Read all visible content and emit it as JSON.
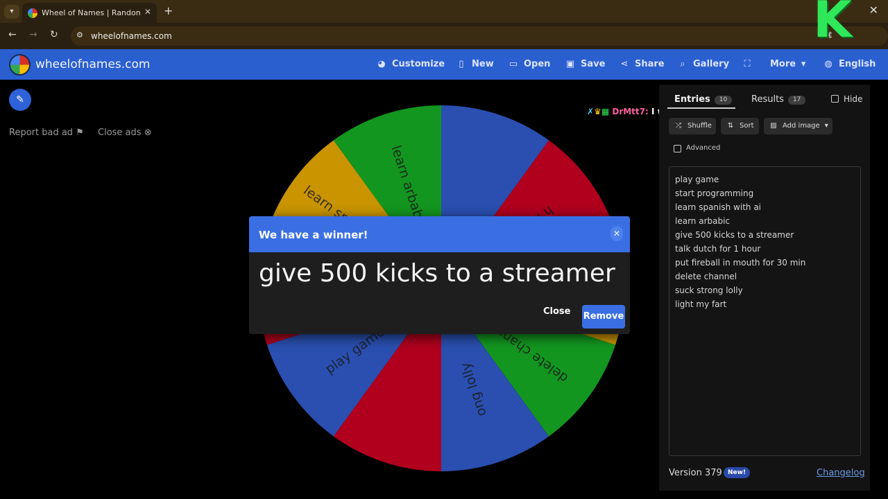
{
  "browser": {
    "tab_title": "Wheel of Names | Random name picker",
    "url": "wheelofnames.com",
    "tab_menu_icon": "chevron-down-icon",
    "new_tab_icon": "plus-icon"
  },
  "app": {
    "brand": "wheelofnames.com",
    "menu": [
      {
        "label": "Customize",
        "icon": "palette-icon"
      },
      {
        "label": "New",
        "icon": "file-icon"
      },
      {
        "label": "Open",
        "icon": "folder-icon"
      },
      {
        "label": "Save",
        "icon": "save-icon"
      },
      {
        "label": "Share",
        "icon": "share-icon"
      },
      {
        "label": "Gallery",
        "icon": "search-icon"
      },
      {
        "label": "",
        "icon": "fullscreen-icon"
      },
      {
        "label": "More",
        "icon": "chevron-down-icon"
      },
      {
        "label": "English",
        "icon": "globe-icon"
      }
    ],
    "brand_color": "#2a5fd0"
  },
  "ads": {
    "report": "Report bad ad",
    "close": "Close ads"
  },
  "wheel": {
    "slices": [
      {
        "label": "play game",
        "color": "#2a4fb0"
      },
      {
        "label": "start programming",
        "color": "#b0001e"
      },
      {
        "label": "learn spanish wit...",
        "color": "#c99400"
      },
      {
        "label": "learn arbabic",
        "color": "#139620"
      },
      {
        "label": "give 500 kicks to ...",
        "color": "#2a4fb0"
      },
      {
        "label": "talk dutch for 1 hour",
        "color": "#b0001e"
      },
      {
        "label": "put fireball in m...",
        "color": "#c99400"
      },
      {
        "label": "delete channel",
        "color": "#139620"
      },
      {
        "label": "suck strong lolly",
        "color": "#2a4fb0"
      },
      {
        "label": "light my fart",
        "color": "#b0001e"
      }
    ],
    "visible_labels": {
      "s0": "play game",
      "s1": "start programming",
      "s2": "learn spanish wit...",
      "s3": "learn arbabic",
      "s6": "t fireball in m...",
      "s5": "h for 1 ...",
      "s7": "delete channel",
      "s8": "ong lolly"
    }
  },
  "chat": {
    "name": "DrMtt7:",
    "message": "I won?"
  },
  "dialog": {
    "title": "We have a winner!",
    "winner": "give 500 kicks to a streamer",
    "close_label": "Close",
    "remove_label": "Remove"
  },
  "panel": {
    "tabs": [
      {
        "label": "Entries",
        "count": "10"
      },
      {
        "label": "Results",
        "count": "17"
      }
    ],
    "hide_label": "Hide",
    "tools": [
      {
        "label": "Shuffle",
        "icon": "shuffle-icon"
      },
      {
        "label": "Sort",
        "icon": "sort-icon"
      },
      {
        "label": "Add image",
        "icon": "image-icon"
      }
    ],
    "advanced_label": "Advanced",
    "entries": [
      "play game",
      "start programming",
      "learn spanish with ai",
      "learn arbabic",
      "give 500 kicks to a streamer",
      "talk dutch for 1 hour",
      "put fireball in mouth for 30 min",
      "delete channel",
      "suck strong lolly",
      "light my fart"
    ],
    "version": "Version 379",
    "new_badge": "New!",
    "changelog": "Changelog"
  }
}
